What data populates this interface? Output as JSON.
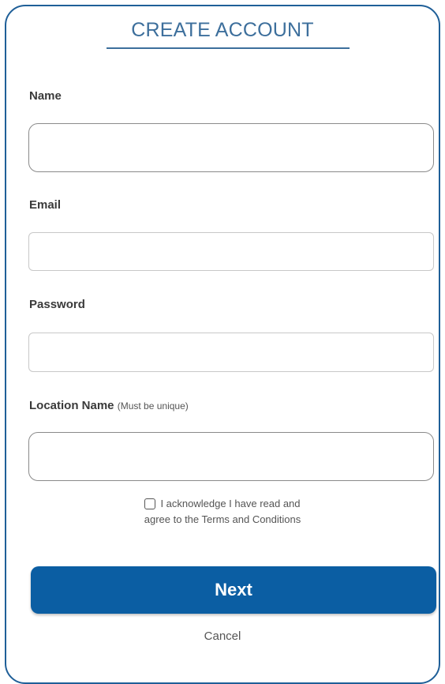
{
  "form": {
    "title": "CREATE ACCOUNT",
    "name_label": "Name",
    "name_value": "",
    "email_label": "Email",
    "email_value": "",
    "password_label": "Password",
    "password_value": "",
    "location_label": "Location Name",
    "location_hint": "(Must be unique)",
    "location_value": "",
    "terms_line1": "I acknowledge I have read and",
    "terms_line2": "agree to the Terms and Conditions",
    "terms_checked": false,
    "next_label": "Next",
    "cancel_label": "Cancel"
  },
  "colors": {
    "accent": "#0b5ea3",
    "title": "#3d6f9c",
    "border": "#1f5f98"
  }
}
